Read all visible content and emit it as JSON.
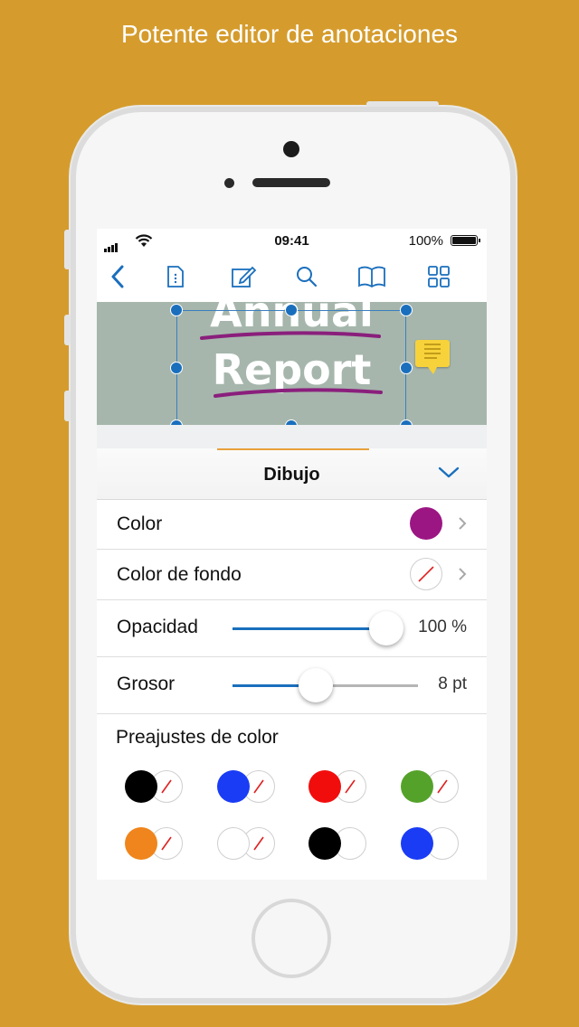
{
  "headline": "Potente editor de anotaciones",
  "status_bar": {
    "time": "09:41",
    "battery": "100%"
  },
  "toolbar": {
    "icons": [
      "back-chevron-icon",
      "document-info-icon",
      "edit-pencil-icon",
      "search-icon",
      "book-icon",
      "grid-icon"
    ]
  },
  "document": {
    "line1": "Annual",
    "line2": "Report"
  },
  "panel": {
    "title": "Dibujo",
    "color_label": "Color",
    "color_value": "#9b1683",
    "bgcolor_label": "Color de fondo",
    "opacity_label": "Opacidad",
    "opacity_value": "100 %",
    "opacity_level": 1.0,
    "thickness_label": "Grosor",
    "thickness_value": "8 pt",
    "thickness_level": 0.45,
    "presets_title": "Preajustes de color",
    "presets": [
      {
        "fg": "#000000",
        "bg": "none"
      },
      {
        "fg": "#1a3cf5",
        "bg": "none"
      },
      {
        "fg": "#f20d0d",
        "bg": "none"
      },
      {
        "fg": "#55a22a",
        "bg": "none"
      },
      {
        "fg": "#ef851c",
        "bg": "none"
      },
      {
        "fg": "#ffffff",
        "bg": "none"
      },
      {
        "fg": "#000000",
        "bg": "#ffffff"
      },
      {
        "fg": "#1a3cf5",
        "bg": "#ffffff"
      }
    ]
  },
  "colors": {
    "accent": "#1a6fbd",
    "background": "#d59c2d",
    "tab_underline": "#e8a13a"
  }
}
